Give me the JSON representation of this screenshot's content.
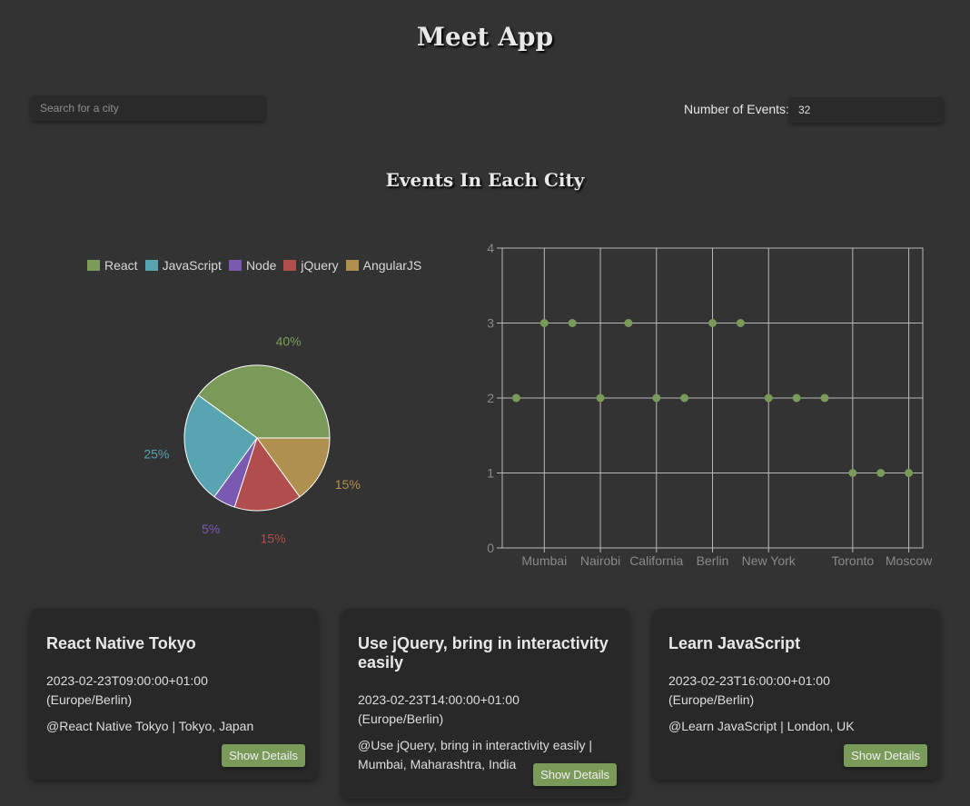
{
  "header": {
    "title": "Meet App"
  },
  "search": {
    "placeholder": "Search for a city",
    "value": ""
  },
  "number_of_events": {
    "label": "Number of Events:",
    "value": "32"
  },
  "section": {
    "title": "Events In Each City"
  },
  "chart_data": [
    {
      "type": "pie",
      "legend_position": "top",
      "slices": [
        {
          "name": "React",
          "value": 40,
          "label": "40%",
          "color": "#7a9a5a"
        },
        {
          "name": "JavaScript",
          "value": 25,
          "label": "25%",
          "color": "#58a4b0"
        },
        {
          "name": "Node",
          "value": 5,
          "label": "5%",
          "color": "#7a5ab0"
        },
        {
          "name": "jQuery",
          "value": 15,
          "label": "15%",
          "color": "#b04e4e"
        },
        {
          "name": "AngularJS",
          "value": 15,
          "label": "15%",
          "color": "#b0904e"
        }
      ]
    },
    {
      "type": "scatter",
      "grid": true,
      "ylim": [
        0,
        4
      ],
      "yticks": [
        "0",
        "1",
        "2",
        "3",
        "4"
      ],
      "xtick_labels": [
        "Mumbai",
        "Nairobi",
        "California",
        "Berlin",
        "New York",
        "Toronto",
        "Moscow"
      ],
      "xtick_positions": [
        1,
        3,
        5,
        7,
        9,
        12,
        14
      ],
      "x_count": 15,
      "color": "#7a9a5a",
      "points": [
        2,
        3,
        3,
        2,
        3,
        2,
        2,
        3,
        3,
        2,
        2,
        2,
        1,
        1,
        1
      ]
    }
  ],
  "events": [
    {
      "title": "React Native Tokyo",
      "date": "2023-02-23T09:00:00+01:00",
      "timezone": "(Europe/Berlin)",
      "location": "@React Native Tokyo | Tokyo, Japan",
      "button": "Show Details"
    },
    {
      "title": "Use jQuery, bring in interactivity easily",
      "date": "2023-02-23T14:00:00+01:00",
      "timezone": "(Europe/Berlin)",
      "location": "@Use jQuery, bring in interactivity easily | Mumbai, Maharashtra, India",
      "button": "Show Details"
    },
    {
      "title": "Learn JavaScript",
      "date": "2023-02-23T16:00:00+01:00",
      "timezone": "(Europe/Berlin)",
      "location": "@Learn JavaScript | London, UK",
      "button": "Show Details"
    }
  ]
}
